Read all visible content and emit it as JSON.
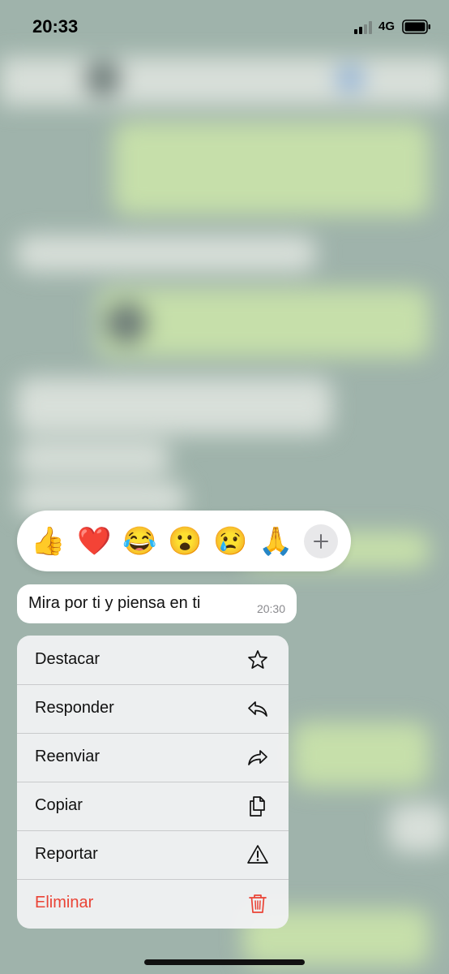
{
  "status_bar": {
    "time": "20:33",
    "network": "4G",
    "signal_icon": "cellular-signal-icon",
    "battery_icon": "battery-icon"
  },
  "reactions": {
    "items": [
      {
        "emoji": "👍",
        "name": "thumbs-up"
      },
      {
        "emoji": "❤️",
        "name": "red-heart"
      },
      {
        "emoji": "😂",
        "name": "tears-of-joy"
      },
      {
        "emoji": "😮",
        "name": "surprised-face"
      },
      {
        "emoji": "😢",
        "name": "crying-face"
      },
      {
        "emoji": "🙏",
        "name": "folded-hands"
      }
    ],
    "more_icon": "plus-icon"
  },
  "message": {
    "text": "Mira por ti y piensa en ti",
    "time": "20:30"
  },
  "menu": {
    "items": [
      {
        "label": "Destacar",
        "icon": "star-icon"
      },
      {
        "label": "Responder",
        "icon": "reply-icon"
      },
      {
        "label": "Reenviar",
        "icon": "forward-icon"
      },
      {
        "label": "Copiar",
        "icon": "copy-icon"
      },
      {
        "label": "Reportar",
        "icon": "warning-icon"
      },
      {
        "label": "Eliminar",
        "icon": "trash-icon"
      }
    ]
  },
  "colors": {
    "danger": "#ea4335",
    "menu_background": "#f0f1f2",
    "background_blur": "#9fb3ab"
  }
}
